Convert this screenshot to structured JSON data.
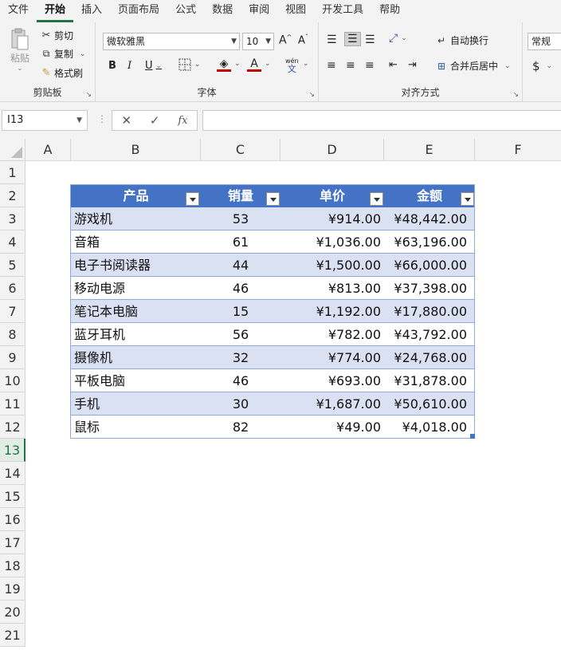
{
  "ribbon_tabs": [
    "文件",
    "开始",
    "插入",
    "页面布局",
    "公式",
    "数据",
    "审阅",
    "视图",
    "开发工具",
    "帮助"
  ],
  "active_tab": "开始",
  "clipboard": {
    "paste": "粘贴",
    "cut": "剪切",
    "copy": "复制",
    "format_painter": "格式刷",
    "group": "剪贴板"
  },
  "font": {
    "name": "微软雅黑",
    "size": "10",
    "group": "字体",
    "wen": "wén",
    "wen_char": "文"
  },
  "alignment": {
    "wrap_text": "自动换行",
    "merge_center": "合并后居中",
    "group": "对齐方式"
  },
  "number": {
    "format": "常规",
    "currency": "$"
  },
  "formula_bar": {
    "name_box": "I13",
    "fx": "fx"
  },
  "columns": [
    "A",
    "B",
    "C",
    "D",
    "E",
    "F"
  ],
  "rows": [
    "1",
    "2",
    "3",
    "4",
    "5",
    "6",
    "7",
    "8",
    "9",
    "10",
    "11",
    "12",
    "13",
    "14",
    "15",
    "16",
    "17",
    "18",
    "19",
    "20",
    "21"
  ],
  "selected_row": "13",
  "table": {
    "headers": [
      "产品",
      "销量",
      "单价",
      "金额"
    ],
    "rows": [
      [
        "游戏机",
        "53",
        "¥914.00",
        "¥48,442.00"
      ],
      [
        "音箱",
        "61",
        "¥1,036.00",
        "¥63,196.00"
      ],
      [
        "电子书阅读器",
        "44",
        "¥1,500.00",
        "¥66,000.00"
      ],
      [
        "移动电源",
        "46",
        "¥813.00",
        "¥37,398.00"
      ],
      [
        "笔记本电脑",
        "15",
        "¥1,192.00",
        "¥17,880.00"
      ],
      [
        "蓝牙耳机",
        "56",
        "¥782.00",
        "¥43,792.00"
      ],
      [
        "摄像机",
        "32",
        "¥774.00",
        "¥24,768.00"
      ],
      [
        "平板电脑",
        "46",
        "¥693.00",
        "¥31,878.00"
      ],
      [
        "手机",
        "30",
        "¥1,687.00",
        "¥50,610.00"
      ],
      [
        "鼠标",
        "82",
        "¥49.00",
        "¥4,018.00"
      ]
    ]
  },
  "colors": {
    "header": "#4472c4",
    "band": "#d9e1f2",
    "accent": "#217346"
  }
}
